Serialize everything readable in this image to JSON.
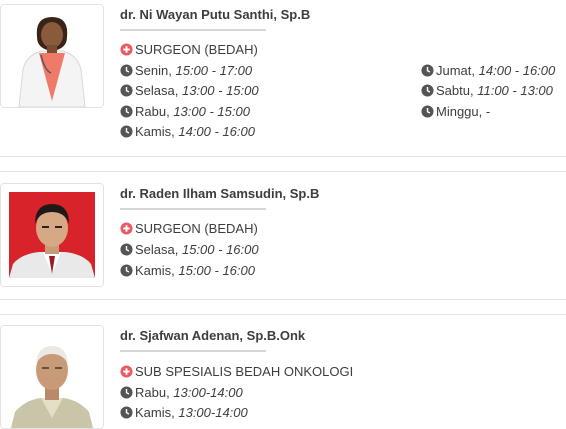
{
  "doctors": [
    {
      "name": "dr. Ni Wayan Putu Santhi, Sp.B",
      "specialty": "SURGEON (BEDAH)",
      "schedule_left": [
        {
          "day": "Senin",
          "time": "15:00 - 17:00"
        },
        {
          "day": "Selasa",
          "time": "13:00 - 15:00"
        },
        {
          "day": "Rabu",
          "time": "13:00 - 15:00"
        },
        {
          "day": "Kamis",
          "time": "14:00 - 16:00"
        }
      ],
      "schedule_right": [
        {
          "day": "Jumat",
          "time": "14:00 - 16:00"
        },
        {
          "day": "Sabtu",
          "time": "11:00 - 13:00"
        },
        {
          "day": "Minggu",
          "time": "-"
        }
      ]
    },
    {
      "name": "dr. Raden Ilham Samsudin, Sp.B",
      "specialty": "SURGEON (BEDAH)",
      "schedule_left": [
        {
          "day": "Selasa",
          "time": "15:00 - 16:00"
        },
        {
          "day": "Kamis",
          "time": "15:00 - 16:00"
        }
      ]
    },
    {
      "name": "dr. Sjafwan Adenan, Sp.B.Onk",
      "specialty": "SUB SPESIALIS BEDAH ONKOLOGI",
      "schedule_left": [
        {
          "day": "Rabu",
          "time": "13:00-14:00"
        },
        {
          "day": "Kamis",
          "time": "13:00-14:00"
        }
      ]
    }
  ],
  "colors": {
    "specialty_icon": "#e85b62",
    "clock_icon": "#555555",
    "photo2_bg": "#d8232a"
  },
  "icons": {
    "specialty": "plus-circle-icon",
    "schedule": "clock-icon"
  }
}
